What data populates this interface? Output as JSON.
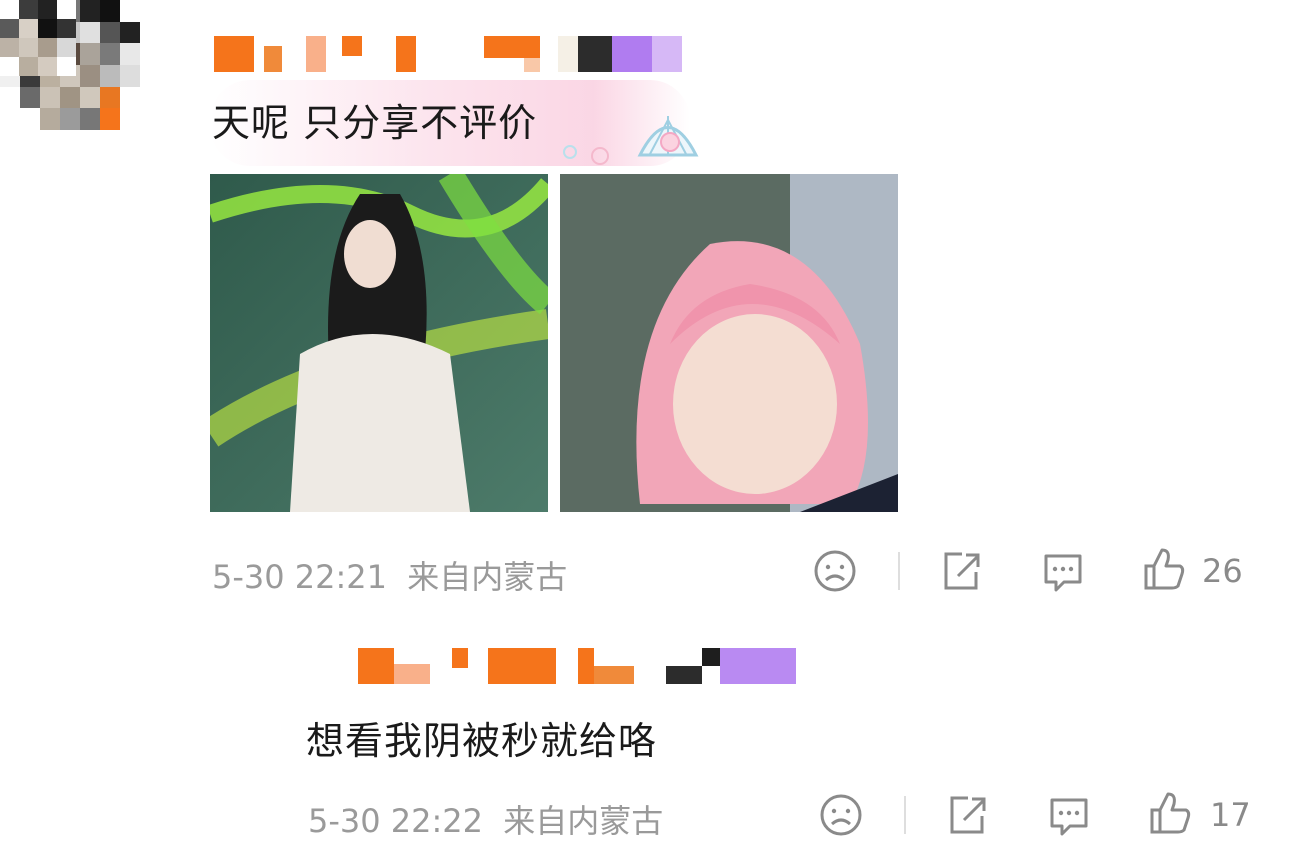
{
  "comment": {
    "text": "天呢 只分享不评价",
    "timestamp": "5-30 22:21",
    "source": "来自内蒙古",
    "likes": "26",
    "photos": [
      {
        "name": "photo-1-icon"
      },
      {
        "name": "photo-2-icon"
      }
    ]
  },
  "reply": {
    "text": "想看我阴被秒就给咯",
    "timestamp": "5-30 22:22",
    "source": "来自内蒙古",
    "likes": "17"
  },
  "icons": {
    "dislike": "sad-face-icon",
    "share": "share-icon",
    "comment": "comment-icon",
    "like": "thumbs-up-icon"
  },
  "colors": {
    "username_orange": "#f5741b",
    "username_purple": "#b07cf0",
    "meta_gray": "#9a9a9a",
    "icon_gray": "#8a8a8a"
  }
}
